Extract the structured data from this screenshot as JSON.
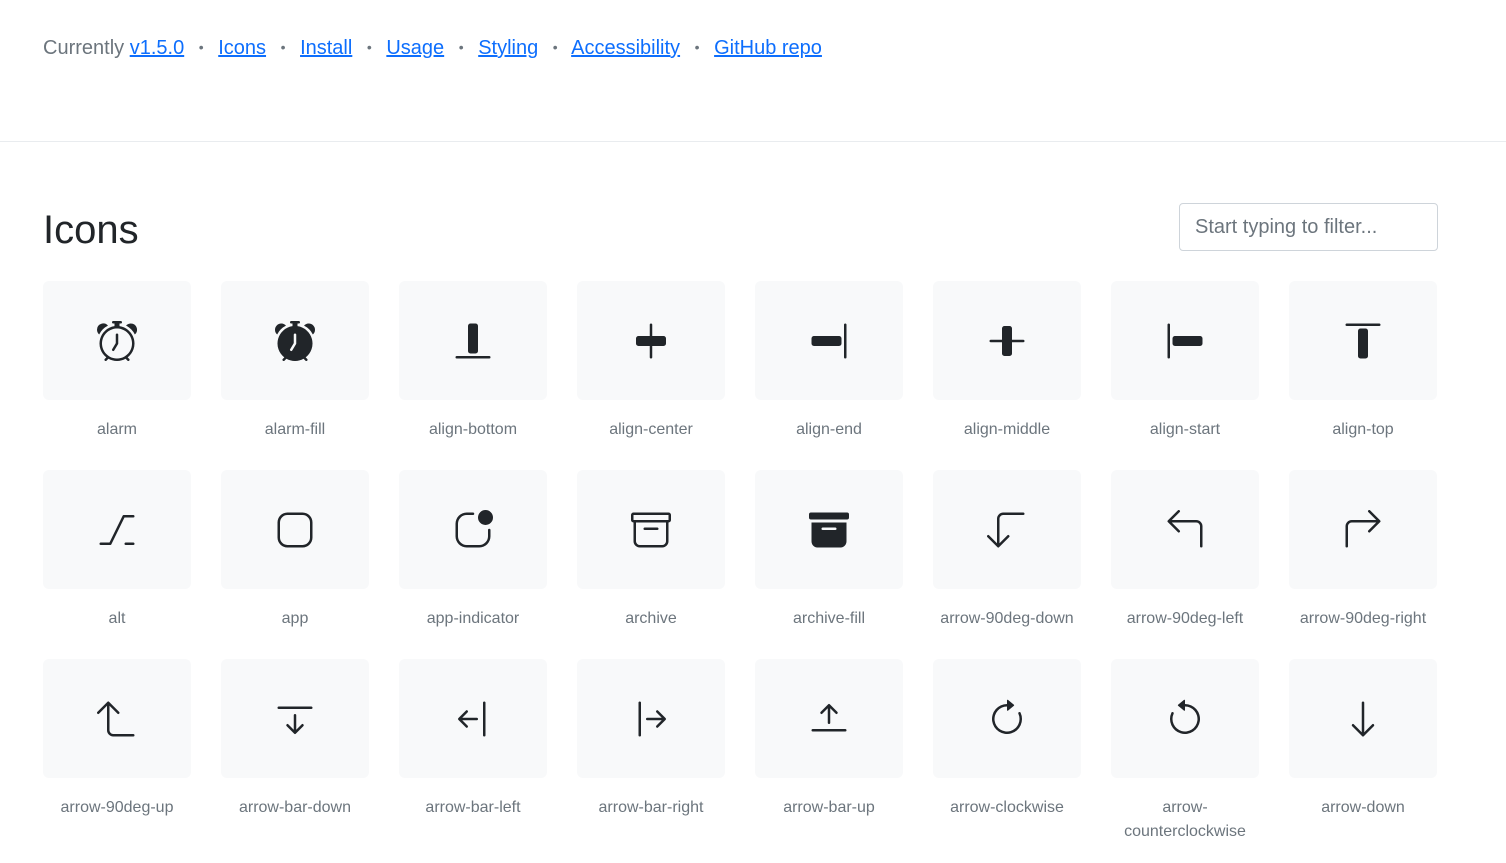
{
  "nav": {
    "prefix": "Currently",
    "links": [
      "v1.5.0",
      "Icons",
      "Install",
      "Usage",
      "Styling",
      "Accessibility",
      "GitHub repo"
    ],
    "separator": "•"
  },
  "main": {
    "title": "Icons",
    "filter_placeholder": "Start typing to filter..."
  },
  "icons": [
    {
      "name": "alarm",
      "icon": "alarm-icon"
    },
    {
      "name": "alarm-fill",
      "icon": "alarm-fill-icon"
    },
    {
      "name": "align-bottom",
      "icon": "align-bottom-icon"
    },
    {
      "name": "align-center",
      "icon": "align-center-icon"
    },
    {
      "name": "align-end",
      "icon": "align-end-icon"
    },
    {
      "name": "align-middle",
      "icon": "align-middle-icon"
    },
    {
      "name": "align-start",
      "icon": "align-start-icon"
    },
    {
      "name": "align-top",
      "icon": "align-top-icon"
    },
    {
      "name": "alt",
      "icon": "alt-icon"
    },
    {
      "name": "app",
      "icon": "app-icon"
    },
    {
      "name": "app-indicator",
      "icon": "app-indicator-icon"
    },
    {
      "name": "archive",
      "icon": "archive-icon"
    },
    {
      "name": "archive-fill",
      "icon": "archive-fill-icon"
    },
    {
      "name": "arrow-90deg-down",
      "icon": "arrow-90deg-down-icon"
    },
    {
      "name": "arrow-90deg-left",
      "icon": "arrow-90deg-left-icon"
    },
    {
      "name": "arrow-90deg-right",
      "icon": "arrow-90deg-right-icon"
    },
    {
      "name": "arrow-90deg-up",
      "icon": "arrow-90deg-up-icon"
    },
    {
      "name": "arrow-bar-down",
      "icon": "arrow-bar-down-icon"
    },
    {
      "name": "arrow-bar-left",
      "icon": "arrow-bar-left-icon"
    },
    {
      "name": "arrow-bar-right",
      "icon": "arrow-bar-right-icon"
    },
    {
      "name": "arrow-bar-up",
      "icon": "arrow-bar-up-icon"
    },
    {
      "name": "arrow-clockwise",
      "icon": "arrow-clockwise-icon"
    },
    {
      "name": "arrow-counterclockwise",
      "icon": "arrow-counterclockwise-icon"
    },
    {
      "name": "arrow-down",
      "icon": "arrow-down-icon"
    }
  ],
  "colors": {
    "link": "#0d6efd",
    "muted": "#6c757d",
    "tile_bg": "#f8f9fa",
    "text": "#212529"
  }
}
